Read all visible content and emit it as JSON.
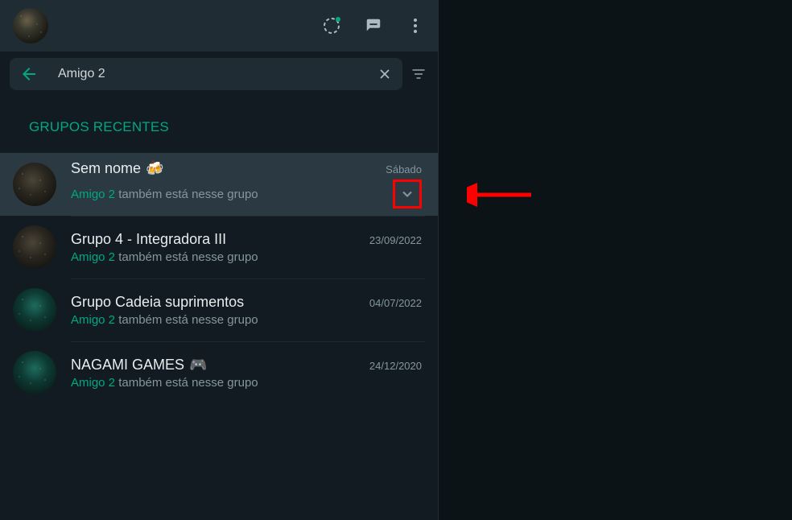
{
  "search": {
    "value": "Amigo 2",
    "placeholder": ""
  },
  "section_header": "GRUPOS RECENTES",
  "subtitle_suffix": " também está nesse grupo",
  "highlight_text": "Amigo 2",
  "chats": [
    {
      "title": "Sem nome",
      "emoji": "🍻",
      "time": "Sábado",
      "avatar_class": "noise-dark",
      "selected": true,
      "show_chevron": true
    },
    {
      "title": "Grupo 4 - Integradora III",
      "emoji": "",
      "time": "23/09/2022",
      "avatar_class": "noise-dark",
      "selected": false,
      "show_chevron": false
    },
    {
      "title": "Grupo Cadeia suprimentos",
      "emoji": "",
      "time": "04/07/2022",
      "avatar_class": "noise-teal",
      "selected": false,
      "show_chevron": false
    },
    {
      "title": "NAGAMI GAMES",
      "emoji": "🎮",
      "time": "24/12/2020",
      "avatar_class": "noise-teal",
      "selected": false,
      "show_chevron": false
    }
  ]
}
